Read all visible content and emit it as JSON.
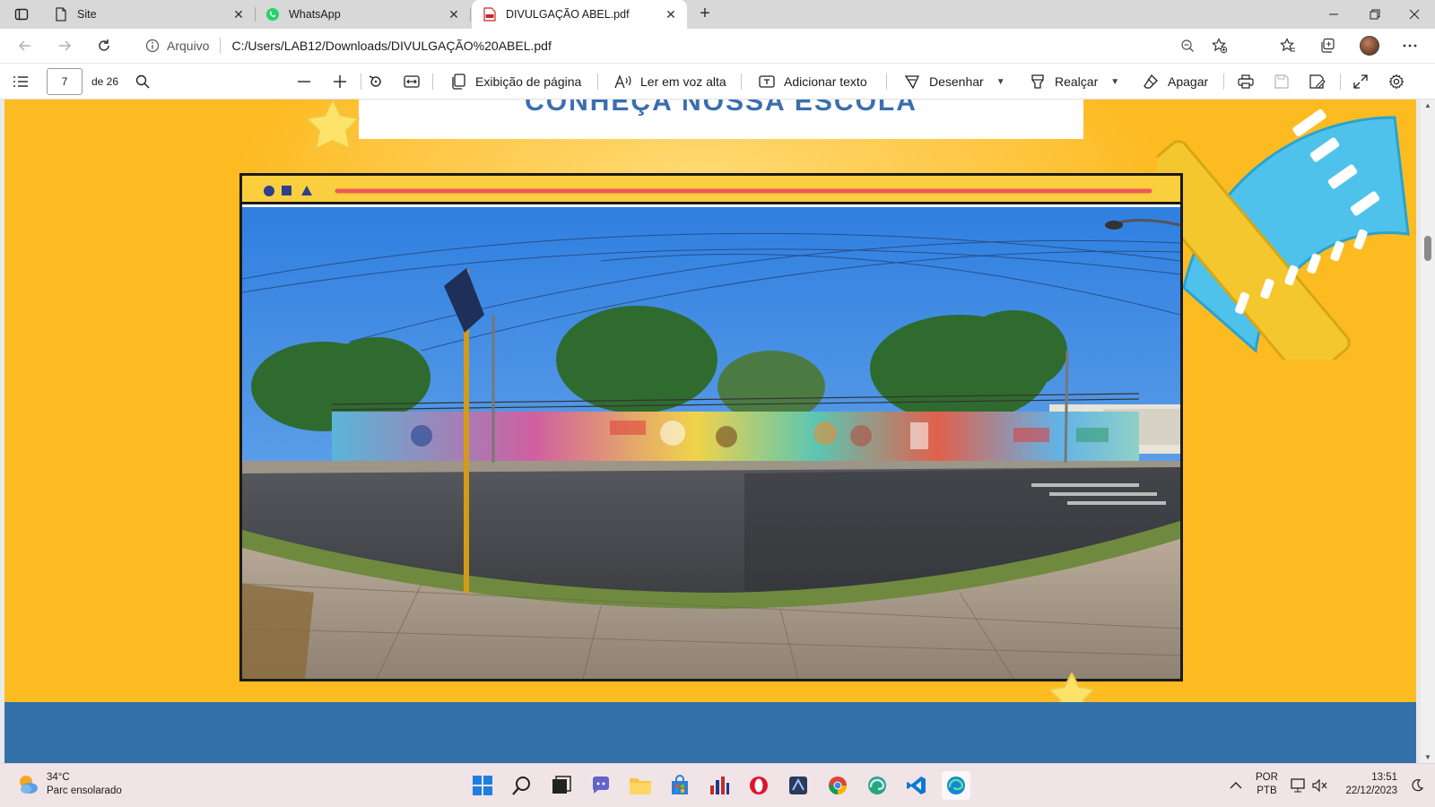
{
  "browser": {
    "tabs": [
      {
        "label": "Site",
        "icon": "page-icon",
        "active": false
      },
      {
        "label": "WhatsApp",
        "icon": "whatsapp-icon",
        "active": false
      },
      {
        "label": "DIVULGAÇÃO ABEL.pdf",
        "icon": "pdf-icon",
        "active": true
      }
    ],
    "new_tab": "+",
    "address": {
      "security_label": "Arquivo",
      "url": "C:/Users/LAB12/Downloads/DIVULGAÇÃO%20ABEL.pdf"
    }
  },
  "pdf_toolbar": {
    "page_number": "7",
    "page_total": "de 26",
    "page_view": "Exibição de página",
    "read_aloud": "Ler em voz alta",
    "add_text": "Adicionar texto",
    "draw": "Desenhar",
    "highlight": "Realçar",
    "erase": "Apagar"
  },
  "document": {
    "title_fragment": "CONHEÇA NOSSA ESCOLA"
  },
  "taskbar": {
    "weather_temp": "34°C",
    "weather_desc": "Parc ensolarado",
    "lang_top": "POR",
    "lang_bottom": "PTB",
    "time": "13:51",
    "date": "22/12/2023"
  },
  "colors": {
    "page_background": "#fdbb22",
    "title_text": "#3a6fb0",
    "frame_bar": "#f9cf3e",
    "frame_line": "#ee5a5a",
    "bottom_band": "#3471a9"
  }
}
